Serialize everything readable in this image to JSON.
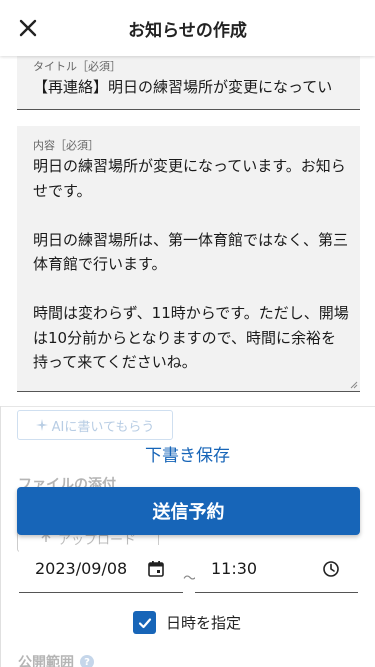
{
  "header": {
    "title": "お知らせの作成",
    "close_icon": "close-icon"
  },
  "form": {
    "title_label": "タイトル［必須］",
    "title_value": "【再連絡】明日の練習場所が変更になってい",
    "content_label": "内容［必須］",
    "content_value": "明日の練習場所が変更になっています。お知らせです。\n\n明日の練習場所は、第一体育館ではなく、第三体育館で行います。\n\n時間は変わらず、11時からです。ただし、開場は10分前からとなりますので、時間に余裕を持って来てくださいね。"
  },
  "actions": {
    "ai_label": "AIに書いてもらう",
    "draft_label": "下書き保存",
    "submit_label": "送信予約"
  },
  "attachment": {
    "label": "ファイルの添付",
    "upload_label": "アップロード"
  },
  "schedule": {
    "date_value": "2023/09/08",
    "time_value": "11:30",
    "separator": "〜",
    "checkbox_label": "日時を指定",
    "checkbox_checked": true
  },
  "scope": {
    "label": "公開範囲",
    "help_glyph": "?"
  },
  "colors": {
    "primary": "#1765b8",
    "field_bg": "#f2f2f2"
  }
}
